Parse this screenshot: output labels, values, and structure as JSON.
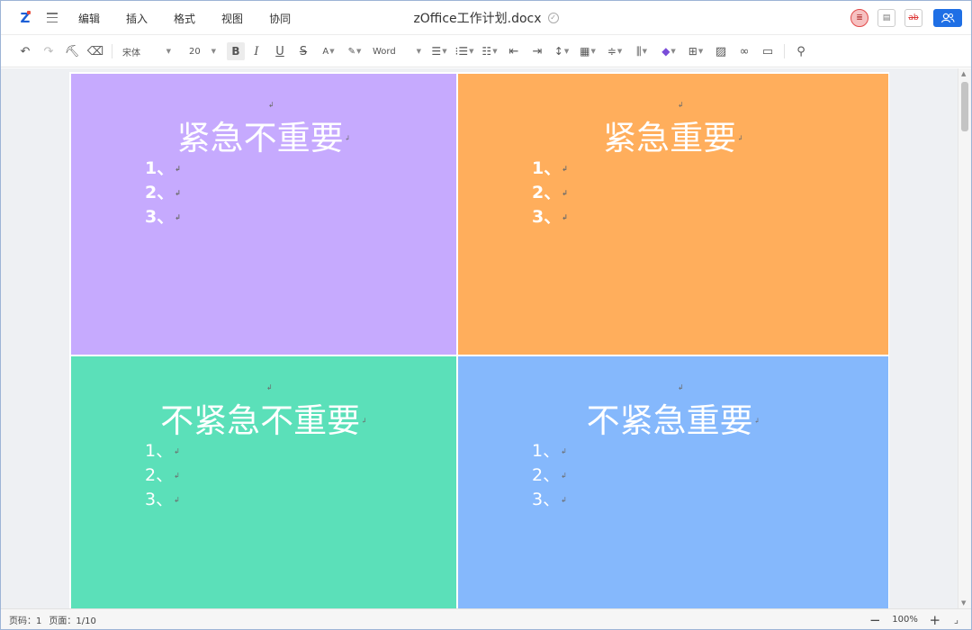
{
  "app": {
    "logo": "Z",
    "menu": [
      "编辑",
      "插入",
      "格式",
      "视图",
      "协同"
    ],
    "doc_title": "zOffice工作计划.docx",
    "saved_icon": "check-circle-icon"
  },
  "toolbar": {
    "font_name": "宋体",
    "font_size": "20",
    "bold": "B",
    "italic": "I",
    "underline": "U",
    "strike": "S",
    "font_color": "A",
    "style_name": "Word"
  },
  "quadrants": [
    {
      "title": "紧急不重要",
      "items": [
        "1、",
        "2、",
        "3、"
      ]
    },
    {
      "title": "紧急重要",
      "items": [
        "1、",
        "2、",
        "3、"
      ]
    },
    {
      "title": "不紧急不重要",
      "items": [
        "1、",
        "2、",
        "3、"
      ]
    },
    {
      "title": "不紧急重要",
      "items": [
        "1、",
        "2、",
        "3、"
      ]
    }
  ],
  "para_mark": "↲",
  "status": {
    "page_code": "页码：1",
    "page_count": "页面：1/10",
    "zoom": "100%",
    "zoom_out": "−",
    "zoom_in": "+"
  },
  "colors": {
    "q1": "#c6aafe",
    "q2": "#ffae5c",
    "q3": "#5be0b9",
    "q4": "#85b8fc",
    "accent": "#1f6fe5"
  }
}
